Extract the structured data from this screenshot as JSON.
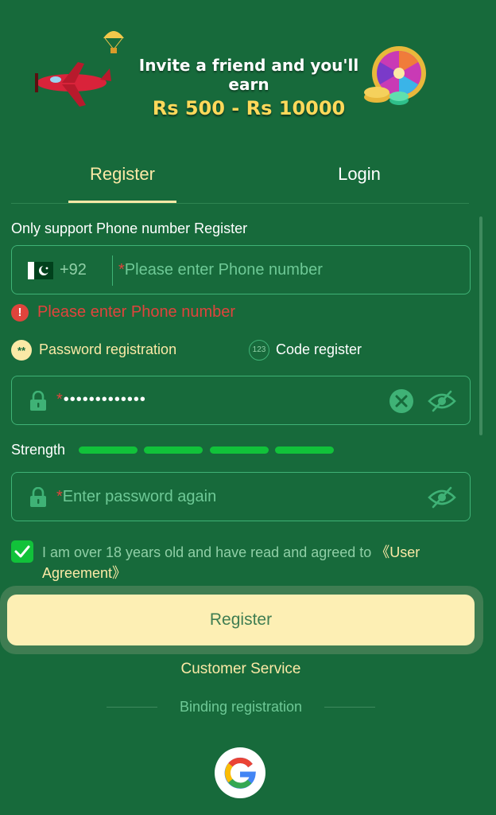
{
  "banner": {
    "line1": "Invite a friend and you'll earn",
    "line2": "Rs 500 - Rs 10000",
    "icons": [
      "airplane-icon",
      "parachute-icon",
      "prize-wheel-icon",
      "coins-icon"
    ]
  },
  "tabs": [
    {
      "label": "Register",
      "active": true
    },
    {
      "label": "Login",
      "active": false
    }
  ],
  "support_text": "Only support Phone number Register",
  "phone": {
    "country_code": "+92",
    "flag": "pakistan-flag-icon",
    "required_mark": "*",
    "placeholder": "Please enter Phone number",
    "error": "Please enter Phone number",
    "error_icon": "!"
  },
  "methods": {
    "password": {
      "label": "Password registration",
      "icon_text": "**",
      "selected": true
    },
    "code": {
      "label": "Code register",
      "icon_text": "123",
      "selected": false
    }
  },
  "password": {
    "required_mark": "*",
    "value": "•••••••••••••"
  },
  "strength": {
    "label": "Strength",
    "level": 4,
    "max": 4
  },
  "confirm_password": {
    "required_mark": "*",
    "placeholder": "Enter password again"
  },
  "agreement": {
    "checked": true,
    "text": "I am over 18 years old and have read and agreed to ",
    "link": "《User Agreement》"
  },
  "register_button": "Register",
  "customer_service": "Customer Service",
  "binding_text": "Binding registration",
  "colors": {
    "background": "#176a3b",
    "accent": "#fbe9a6",
    "error": "#e0443c",
    "strength": "#11c23a",
    "border": "#3fb276"
  }
}
